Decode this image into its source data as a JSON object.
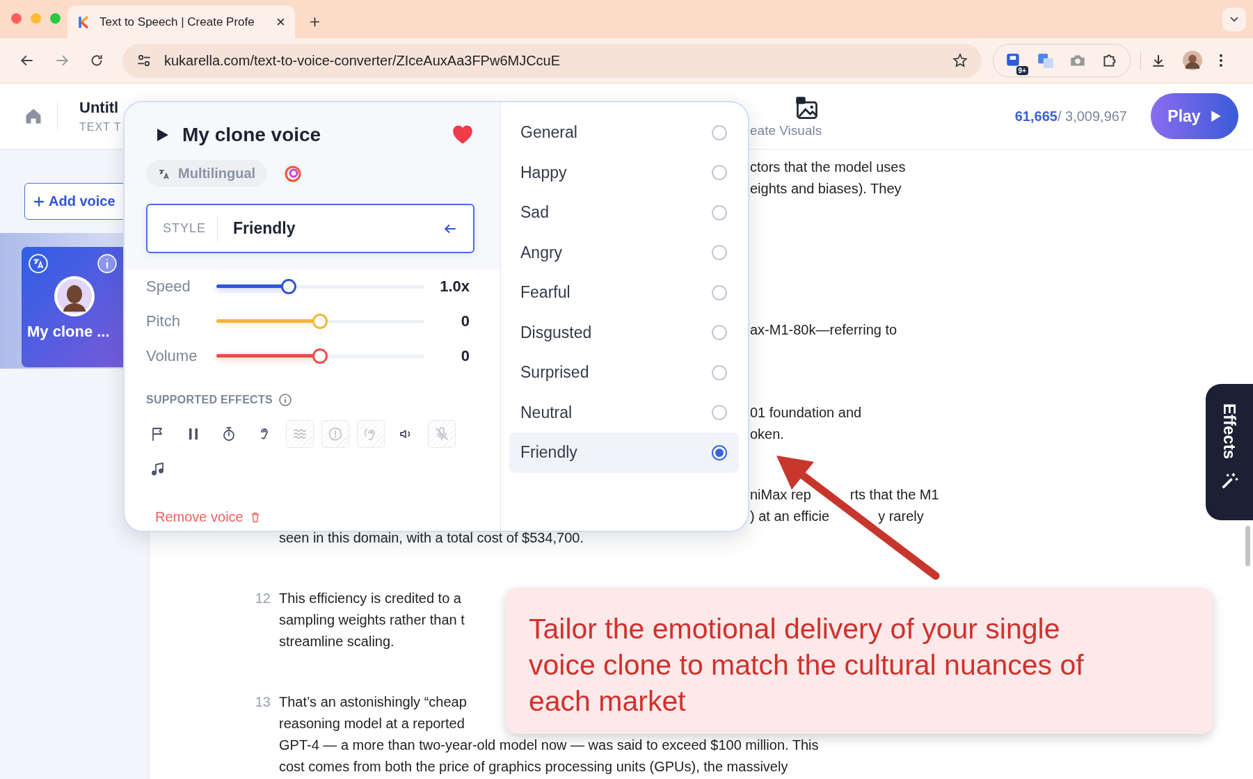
{
  "browser": {
    "tab_title": "Text to Speech | Create Profe",
    "url": "kukarella.com/text-to-voice-converter/ZIceAuxAa3FPw6MJCcuE",
    "extension_badge": "9+"
  },
  "header": {
    "title": "Untitl",
    "subtitle": "TEXT T",
    "create_visuals": "eate Visuals",
    "count_used": "61,665",
    "count_total": "/ 3,009,967",
    "play": "Play"
  },
  "sidebar": {
    "add_voice": "Add voice",
    "voice_card": {
      "name": "My clone ...",
      "selected": true
    }
  },
  "voice_popup": {
    "name": "My clone voice",
    "favorite": true,
    "tag": "Multilingual",
    "style_label": "STYLE",
    "style_value": "Friendly",
    "sliders": [
      {
        "label": "Speed",
        "level": 0.35,
        "reading": "1.0x",
        "color": "#2f55d4"
      },
      {
        "label": "Pitch",
        "level": 0.5,
        "reading": "0",
        "color": "#f7b53a"
      },
      {
        "label": "Volume",
        "level": 0.5,
        "reading": "0",
        "color": "#f04b4b"
      }
    ],
    "effects_title": "SUPPORTED EFFECTS",
    "effects": [
      {
        "kind": "flag",
        "disabled": false
      },
      {
        "kind": "pause",
        "disabled": false
      },
      {
        "kind": "stopwatch",
        "disabled": false
      },
      {
        "kind": "ear",
        "disabled": false
      },
      {
        "kind": "waves",
        "disabled": true
      },
      {
        "kind": "alert",
        "disabled": true
      },
      {
        "kind": "ear-wave",
        "disabled": true
      },
      {
        "kind": "speaker",
        "disabled": false
      },
      {
        "kind": "muted-mic",
        "disabled": true
      },
      {
        "kind": "music-note",
        "disabled": false
      }
    ],
    "remove": "Remove voice",
    "styles": [
      {
        "label": "General",
        "selected": false
      },
      {
        "label": "Happy",
        "selected": false
      },
      {
        "label": "Sad",
        "selected": false
      },
      {
        "label": "Angry",
        "selected": false
      },
      {
        "label": "Fearful",
        "selected": false
      },
      {
        "label": "Disgusted",
        "selected": false
      },
      {
        "label": "Surprised",
        "selected": false
      },
      {
        "label": "Neutral",
        "selected": false
      },
      {
        "label": "Friendly",
        "selected": true
      }
    ]
  },
  "document": {
    "covered_lines": [
      [
        "ctors that the model uses",
        "eights and biases). They"
      ],
      [
        "ax-M1-80k—referring to"
      ],
      [
        "01 foundation and",
        "oken."
      ],
      [
        [
          "niMax rep",
          "rts that the M1"
        ],
        [
          ") at an efficie",
          "y rarely"
        ]
      ]
    ],
    "paragraphs": [
      {
        "lines": [
          "seen in this domain, with a total cost of $534,700."
        ]
      },
      {
        "number": "12",
        "lines": [
          "This efficiency is credited to a",
          "sampling weights rather than t",
          "streamline scaling."
        ]
      },
      {
        "number": "13",
        "lines": [
          "That’s an astonishingly “cheap",
          "reasoning model at a reported",
          "GPT-4 — a more than two-year-old model now — was said to exceed $100 million. This",
          "cost comes from both the price of graphics processing units (GPUs), the massively"
        ]
      }
    ]
  },
  "callout": {
    "text": "Tailor the emotional delivery of your single voice clone to match the cultural nuances of each market"
  },
  "effects_tab": {
    "label": "Effects"
  }
}
